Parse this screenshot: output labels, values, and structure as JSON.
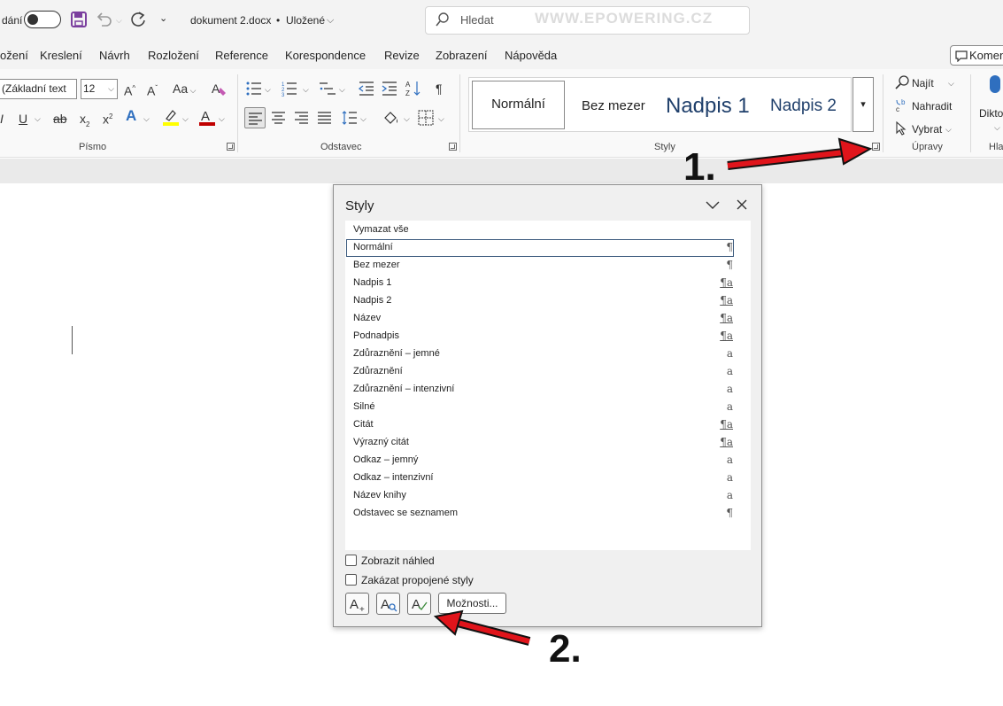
{
  "titlebar": {
    "autosave_label": "dání",
    "doc_title": "dokument 2.docx",
    "dot": "•",
    "save_status": "Uložené",
    "search_placeholder": "Hledat",
    "watermark": "WWW.EPOWERING.CZ"
  },
  "menu": [
    "ožení",
    "Kreslení",
    "Návrh",
    "Rozložení",
    "Reference",
    "Korespondence",
    "Revize",
    "Zobrazení",
    "Nápověda"
  ],
  "comment_button": "Komen",
  "ribbon": {
    "font_name": "(Základní text",
    "font_size": "12",
    "change_case": "Aa",
    "groups": {
      "font": "Písmo",
      "paragraph": "Odstavec",
      "styles": "Styly",
      "editing": "Úpravy",
      "voice": "Hla"
    },
    "gallery": [
      "Normální",
      "Bez mezer",
      "Nadpis 1",
      "Nadpis 2"
    ],
    "editing": {
      "find": "Najít",
      "replace": "Nahradit",
      "select": "Vybrat"
    },
    "dictate": "Dikto"
  },
  "styles_pane": {
    "title": "Styly",
    "clear_all": "Vymazat vše",
    "items": [
      {
        "name": "Normální",
        "icon": "¶"
      },
      {
        "name": "Bez mezer",
        "icon": "¶"
      },
      {
        "name": "Nadpis 1",
        "icon": "¶a"
      },
      {
        "name": "Nadpis 2",
        "icon": "¶a"
      },
      {
        "name": "Název",
        "icon": "¶a"
      },
      {
        "name": "Podnadpis",
        "icon": "¶a"
      },
      {
        "name": "Zdůraznění – jemné",
        "icon": "a"
      },
      {
        "name": "Zdůraznění",
        "icon": "a"
      },
      {
        "name": "Zdůraznění – intenzivní",
        "icon": "a"
      },
      {
        "name": "Silné",
        "icon": "a"
      },
      {
        "name": "Citát",
        "icon": "¶a"
      },
      {
        "name": "Výrazný citát",
        "icon": "¶a"
      },
      {
        "name": "Odkaz – jemný",
        "icon": "a"
      },
      {
        "name": "Odkaz – intenzivní",
        "icon": "a"
      },
      {
        "name": "Název knihy",
        "icon": "a"
      },
      {
        "name": "Odstavec se seznamem",
        "icon": "¶"
      }
    ],
    "selected": "Normální",
    "show_preview": "Zobrazit náhled",
    "disable_linked": "Zakázat propojené styly",
    "options_button": "Možnosti..."
  },
  "annotations": {
    "step1": "1.",
    "step2": "2."
  },
  "colors": {
    "arrow": "#e0141b",
    "highlight": "#ffff00",
    "font_color": "#c00000",
    "save_icon": "#7b3f9e"
  }
}
